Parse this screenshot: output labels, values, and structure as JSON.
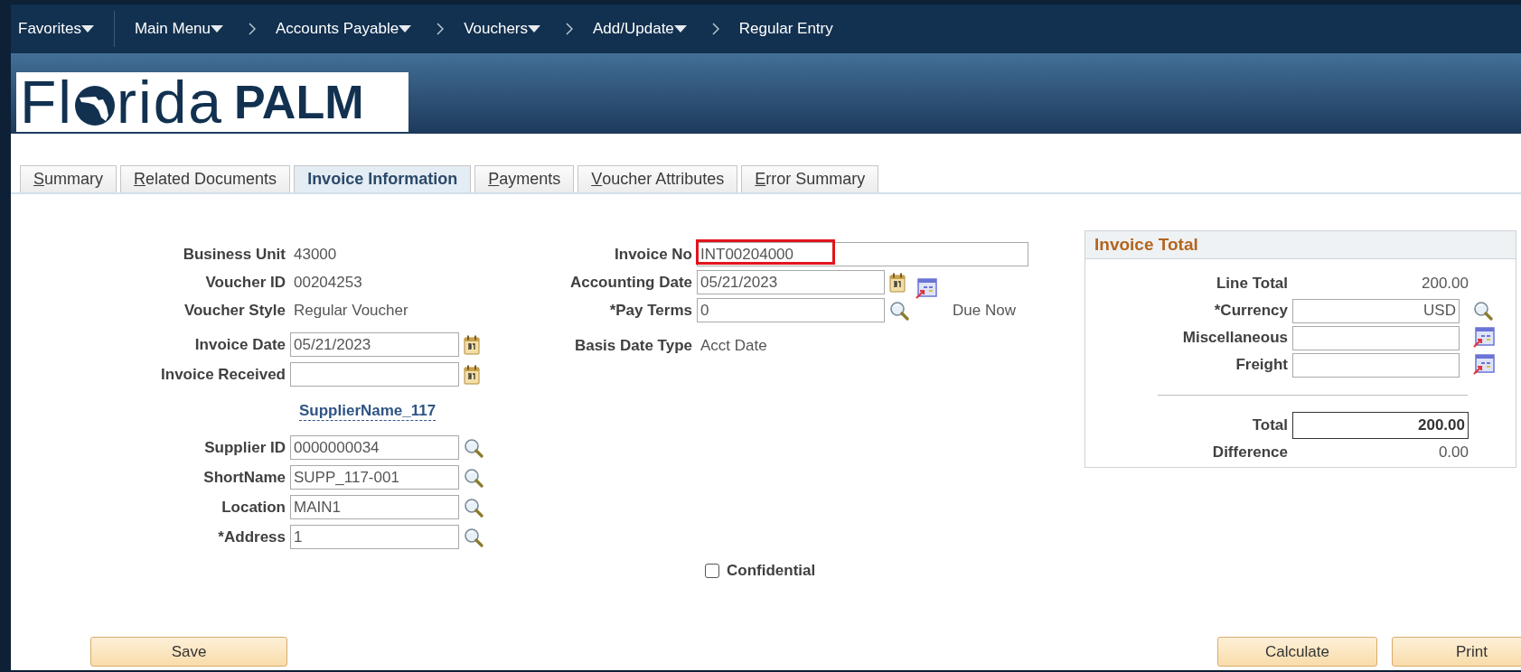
{
  "nav": {
    "items": [
      {
        "label": "Favorites",
        "kind": "menu"
      },
      {
        "label": "Main Menu",
        "kind": "menu"
      },
      {
        "label": "Accounts Payable",
        "kind": "crumb"
      },
      {
        "label": "Vouchers",
        "kind": "crumb"
      },
      {
        "label": "Add/Update",
        "kind": "crumb"
      },
      {
        "label": "Regular Entry",
        "kind": "current"
      }
    ]
  },
  "logo": {
    "before": "Fl",
    "after": "rida",
    "bold": "PALM"
  },
  "tabs": [
    {
      "label": "Summary",
      "access_key_underlined": true,
      "selected": false
    },
    {
      "label": "Related Documents",
      "access_key_underlined": true,
      "selected": false
    },
    {
      "label": "Invoice Information",
      "selected": true
    },
    {
      "label": "Payments",
      "access_key_underlined": true,
      "selected": false
    },
    {
      "label": "Voucher Attributes",
      "access_key_underlined": true,
      "selected": false
    },
    {
      "label": "Error Summary",
      "access_key_underlined": true,
      "selected": false
    }
  ],
  "left_fields": [
    {
      "label": "Business Unit",
      "value": "43000",
      "kind": "static"
    },
    {
      "label": "Voucher ID",
      "value": "00204253",
      "kind": "static"
    },
    {
      "label": "Voucher Style",
      "value": "Regular Voucher",
      "kind": "static"
    },
    {
      "label": "Invoice Date",
      "value": "05/21/2023",
      "kind": "date"
    },
    {
      "label": "Invoice Received",
      "kind": "date"
    },
    {
      "value": "SupplierName_117",
      "kind": "link"
    },
    {
      "label": "Supplier ID",
      "value": "0000000034",
      "kind": "lookup"
    },
    {
      "label": "ShortName",
      "value": "SUPP_117-001",
      "kind": "lookup"
    },
    {
      "label": "Location",
      "value": "MAIN1",
      "kind": "lookup"
    },
    {
      "label": "*Address",
      "value": "1",
      "kind": "lookup"
    }
  ],
  "middle_fields": [
    {
      "label": "Invoice No",
      "value": "INT00204000",
      "kind": "text",
      "highlighted": true
    },
    {
      "label": "Accounting Date",
      "value": "05/21/2023",
      "kind": "date",
      "details_icon": true
    },
    {
      "label": "*Pay Terms",
      "value": "0",
      "kind": "lookup",
      "note": "Due Now"
    },
    {
      "label": "Basis Date Type",
      "value": "Acct Date",
      "kind": "static"
    }
  ],
  "confidential": {
    "label": "Confidential",
    "checked": false
  },
  "invoice_total": {
    "title": "Invoice Total",
    "rows": [
      {
        "label": "Line Total",
        "value": "200.00",
        "kind": "static"
      },
      {
        "label": "*Currency",
        "value": "USD",
        "kind": "lookup"
      },
      {
        "label": "Miscellaneous",
        "kind": "detail"
      },
      {
        "label": "Freight",
        "kind": "detail"
      },
      {
        "kind": "divider"
      },
      {
        "label": "Total",
        "value": "200.00",
        "kind": "total"
      },
      {
        "label": "Difference",
        "value": "0.00",
        "kind": "static"
      }
    ]
  },
  "left_buttons": [
    {
      "label": "Save"
    }
  ],
  "right_buttons": [
    {
      "label": "Calculate"
    },
    {
      "label": "Print"
    }
  ]
}
